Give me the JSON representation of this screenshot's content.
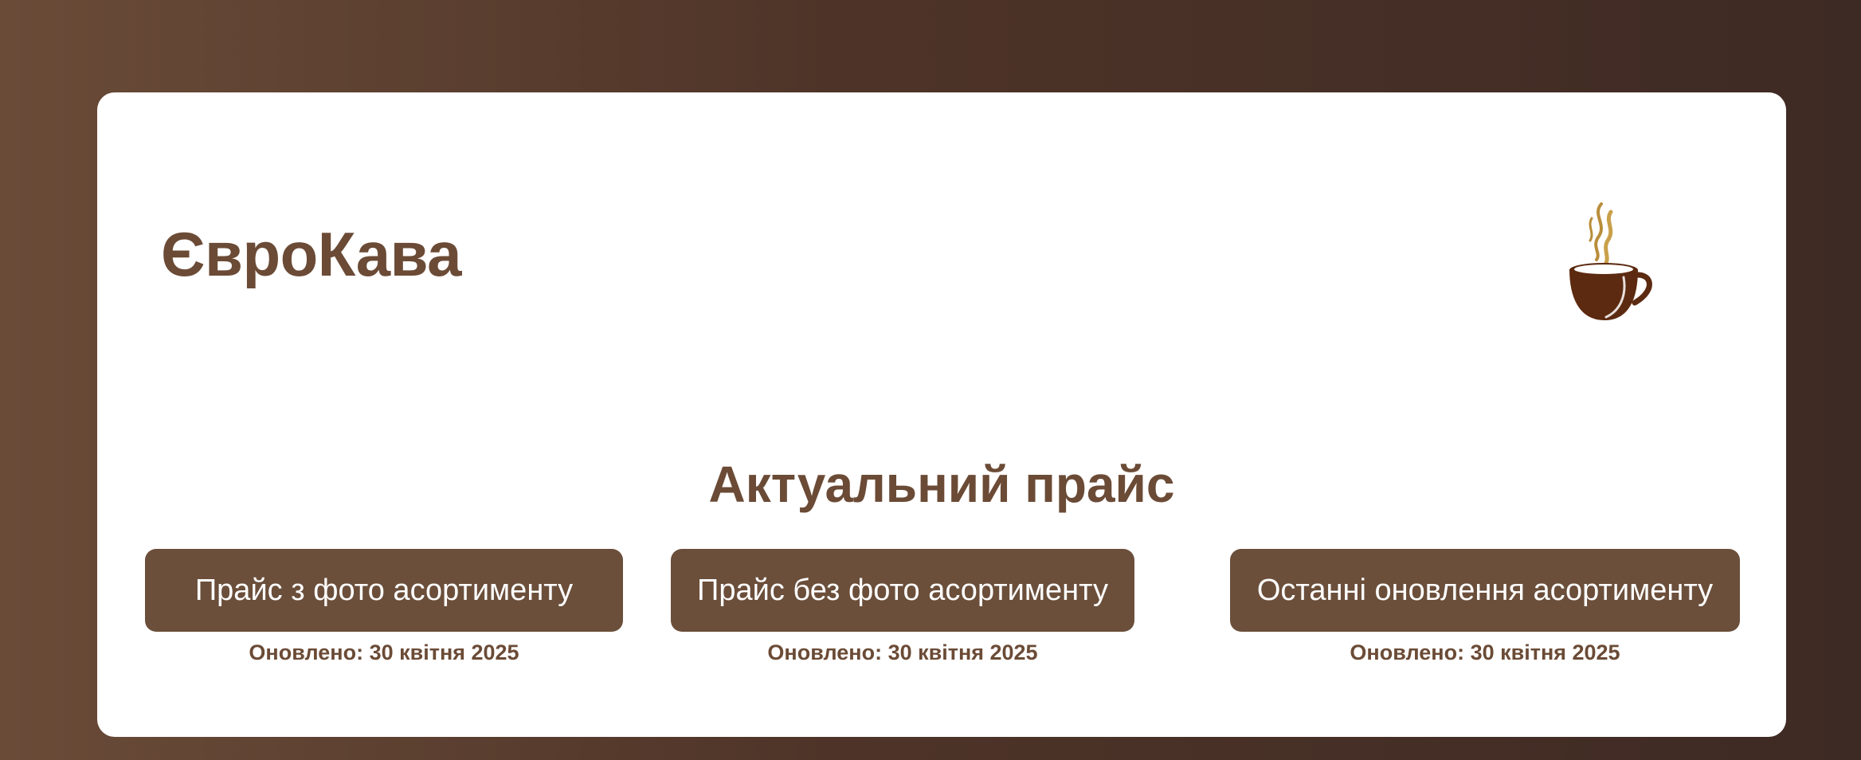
{
  "brand": {
    "name": "ЄвроКава",
    "logo_icon": "coffee-cup-icon"
  },
  "main": {
    "heading": "Актуальний прайс",
    "price_lists": [
      {
        "label": "Прайс з фото асортименту",
        "updated": "Оновлено: 30 квітня 2025"
      },
      {
        "label": "Прайс без фото асортименту",
        "updated": "Оновлено: 30 квітня 2025"
      },
      {
        "label": "Останні оновлення асортименту",
        "updated": "Оновлено: 30 квітня 2025"
      }
    ]
  },
  "colors": {
    "accent": "#6b4f3b",
    "text_brown": "#6b4b36",
    "background_start": "#6a4b38",
    "background_end": "#3e2a24",
    "card": "#ffffff"
  }
}
